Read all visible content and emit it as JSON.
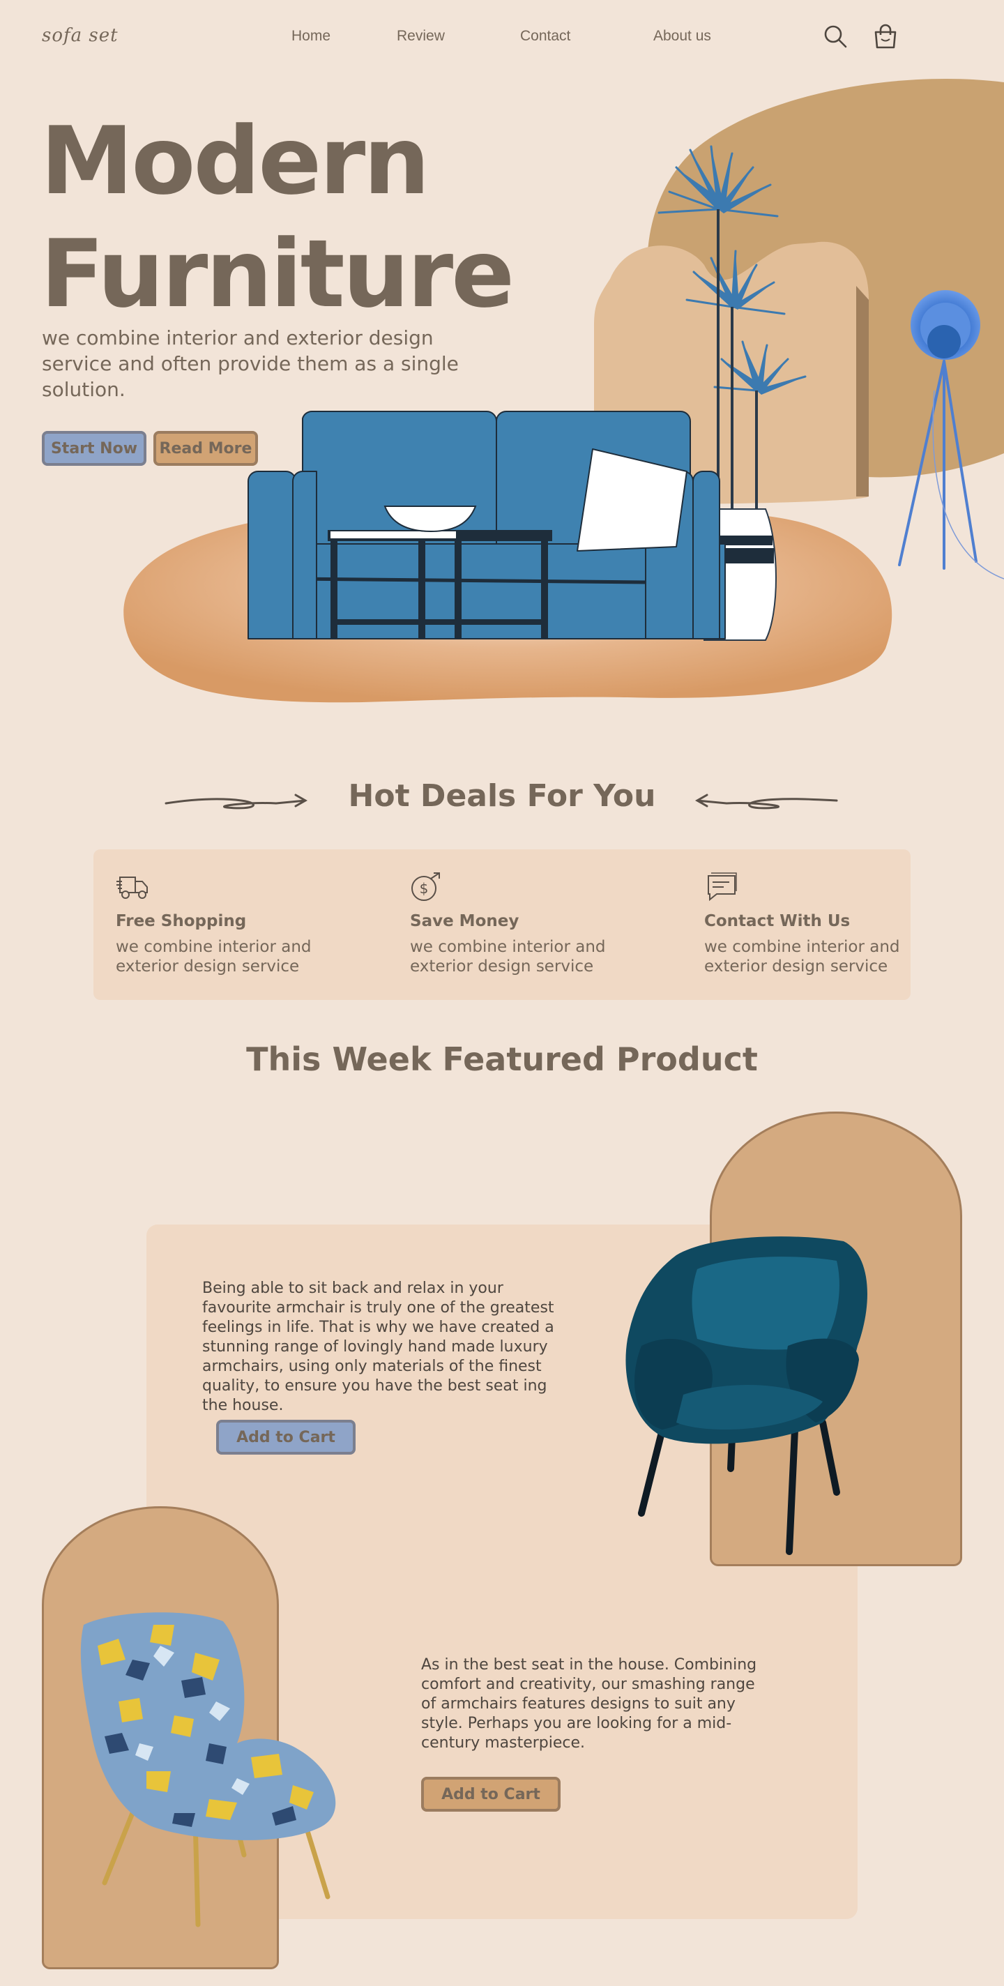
{
  "nav": {
    "logo": "sofa set",
    "links": [
      "Home",
      "Review",
      "Contact",
      "About us"
    ],
    "icons": [
      "search-icon",
      "shopping-bag-icon"
    ]
  },
  "hero": {
    "title_line1": "Modern",
    "title_line2": "Furniture",
    "subtitle": "we combine interior and exterior design service and often provide them as a single solution.",
    "start_button": "Start Now",
    "read_button": "Read More"
  },
  "deals": {
    "title": "Hot Deals For You",
    "items": [
      {
        "icon": "delivery-truck-icon",
        "title": "Free Shopping",
        "text": "we combine interior and exterior design service"
      },
      {
        "icon": "dollar-coin-icon",
        "title": "Save Money",
        "text": "we combine interior and exterior design service"
      },
      {
        "icon": "chat-message-icon",
        "title": "Contact With Us",
        "text": "we combine interior and exterior design service"
      }
    ]
  },
  "featured": {
    "title": "This Week Featured Product",
    "products": [
      {
        "description": "Being able to sit back and relax in your favourite armchair is truly one of the greatest feelings in life. That is why we have created a stunning range of lovingly hand made luxury armchairs, using only materials of the finest quality, to ensure you have the best seat ing the house.",
        "button": "Add to Cart"
      },
      {
        "description": "As in the best seat in the house. Combining comfort and creativity, our smashing range of armchairs features designs to suit any style. Perhaps you are looking for a mid-century masterpiece.",
        "button": "Add to Cart"
      }
    ]
  },
  "colors": {
    "background": "#f2e4d8",
    "text": "#756759",
    "sofa_blue": "#3f82b0",
    "tan": "#d4aa80",
    "panel": "#f0d9c5",
    "button_blue": "#8fa4c8",
    "button_tan": "#d1a374"
  }
}
